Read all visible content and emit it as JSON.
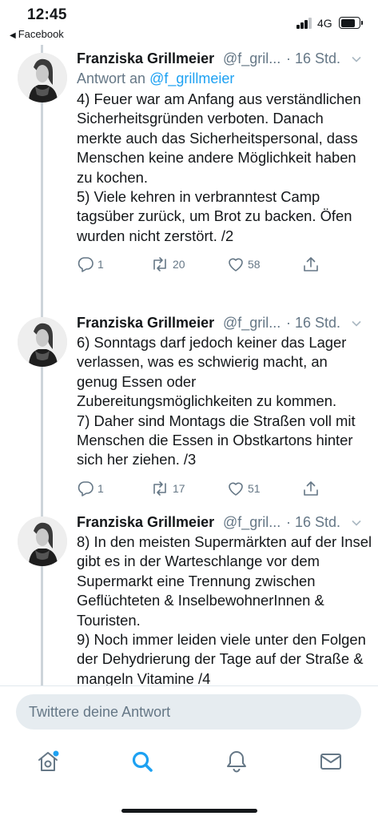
{
  "status_bar": {
    "time": "12:45",
    "back_app": "Facebook",
    "network": "4G"
  },
  "tweets": [
    {
      "name": "Franziska Grillmeier",
      "handle": "@f_gril...",
      "separator": "·",
      "time": "16 Std.",
      "reply_to_prefix": "Antwort an",
      "reply_to_handle": "@f_grillmeier",
      "text": "4) Feuer war am Anfang aus verständlichen Sicherheitsgründen verboten. Danach merkte auch das Sicherheitspersonal, dass Menschen keine andere Möglichkeit haben zu kochen.\n5) Viele kehren in verbranntest Camp tagsüber zurück, um Brot zu backen. Öfen wurden nicht zerstört. /2",
      "replies": "1",
      "retweets": "20",
      "likes": "58"
    },
    {
      "name": "Franziska Grillmeier",
      "handle": "@f_gril...",
      "separator": "·",
      "time": "16 Std.",
      "text": "6) Sonntags darf jedoch keiner das Lager verlassen, was es schwierig macht, an genug Essen oder Zubereitungsmöglichkeiten zu kommen.\n7) Daher sind Montags die Straßen voll mit Menschen die Essen in Obstkartons hinter sich her ziehen. /3",
      "replies": "1",
      "retweets": "17",
      "likes": "51"
    },
    {
      "name": "Franziska Grillmeier",
      "handle": "@f_gril...",
      "separator": "·",
      "time": "16 Std.",
      "text": "8) In den meisten Supermärkten auf der Insel gibt es in der Warteschlange vor dem Supermarkt eine Trennung zwischen Geflüchteten & InselbewohnerInnen & Touristen.\n9) Noch immer leiden viele unter den Folgen der Dehydrierung der Tage auf der Straße & mangeln Vitamine /4"
    }
  ],
  "reply_bar": {
    "placeholder": "Twittere deine Antwort"
  },
  "tabs": [
    {
      "icon": "home-icon",
      "active": false,
      "notification_dot": true
    },
    {
      "icon": "search-icon",
      "active": true
    },
    {
      "icon": "notifications-bell-icon",
      "active": false
    },
    {
      "icon": "messages-envelope-icon",
      "active": false
    }
  ],
  "colors": {
    "accent": "#1da1f2",
    "secondary_text": "#657786",
    "primary_text": "#14171a",
    "thread_line": "#cdd4da",
    "input_bg": "#e6ecf0"
  }
}
